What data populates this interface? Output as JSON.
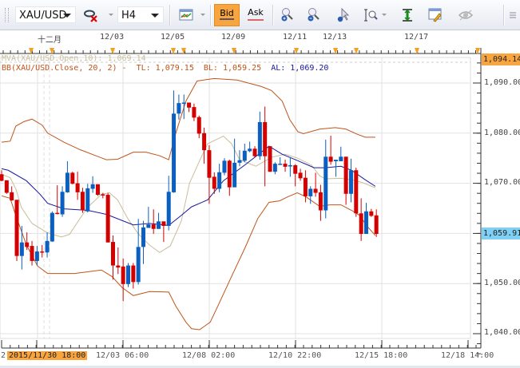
{
  "toolbar": {
    "symbol": "XAU/USD",
    "timeframe": "H4",
    "bid_label": "Bid",
    "ask_label": "Ask",
    "icons": [
      "remove-indicator-icon",
      "chart-type-icon",
      "zoom-in-icon",
      "zoom-out-icon",
      "cursor-zoom-icon",
      "zoom-range-icon",
      "crosshair-icon",
      "edit-icon",
      "eye-icon",
      "menu-icon"
    ]
  },
  "ruler": {
    "labels": [
      "十二月",
      "12/03",
      "12/05",
      "12/09",
      "12/11",
      "12/13",
      "12/17"
    ]
  },
  "legend": {
    "mva": "MVA(XAU/USD.Open,10): 1,069.14",
    "bb_name": "BB(XAU/USD.Close, 20, 2) -",
    "tl": "TL: 1,079.15",
    "bl": "BL: 1,059.25",
    "al": "AL: 1,069.20"
  },
  "price_axis": {
    "labels": [
      "1,090.00",
      "1,080.00",
      "1,070.00",
      "1,050.00",
      "1,040.00"
    ],
    "high_marker": "1,094.14",
    "current_price": "1,059.91"
  },
  "time_axis": {
    "highlighted": "2015/11/30 18:00",
    "clipped_prefix": "2",
    "labels": [
      "12/03 06:00",
      "12/08 02:00",
      "12/10 22:00",
      "12/15 18:00",
      "12/18 14:00"
    ]
  },
  "colors": {
    "up": "#0a5fc0",
    "down": "#d40000",
    "bands": "#c0541a",
    "mid": "#1818a0",
    "mva": "#c9bd98",
    "accent": "#f9a53f",
    "current": "#7fd0f5"
  },
  "chart_data": {
    "type": "candlestick",
    "title": "XAU/USD H4",
    "ylim": [
      1036.5,
      1095.5
    ],
    "yticks": [
      1040,
      1050,
      1060,
      1070,
      1080,
      1090
    ],
    "ohlc": [
      [
        1071.8,
        1072.6,
        1070.4,
        1070.5
      ],
      [
        1070.6,
        1070.6,
        1067.9,
        1068.1
      ],
      [
        1068.2,
        1069.4,
        1066.5,
        1066.6
      ],
      [
        1066.7,
        1066.7,
        1054.5,
        1055.5
      ],
      [
        1055.5,
        1061.5,
        1052.8,
        1058.2
      ],
      [
        1058.2,
        1060.2,
        1056.7,
        1057.3
      ],
      [
        1057.5,
        1058.5,
        1053.6,
        1054.5
      ],
      [
        1054.5,
        1057.5,
        1053.6,
        1056.4
      ],
      [
        1056.4,
        1057.7,
        1055.2,
        1056.3
      ],
      [
        1056.2,
        1060.2,
        1055.2,
        1058.5
      ],
      [
        1058.4,
        1064.4,
        1058.3,
        1064.1
      ],
      [
        1064.1,
        1069.6,
        1063.8,
        1063.9
      ],
      [
        1063.8,
        1069.4,
        1063.3,
        1068.3
      ],
      [
        1068.2,
        1074.4,
        1068.1,
        1072.1
      ],
      [
        1072.1,
        1072.3,
        1069.8,
        1069.9
      ],
      [
        1070.0,
        1072.3,
        1066.7,
        1068.2
      ],
      [
        1068.3,
        1069.1,
        1064.1,
        1064.6
      ],
      [
        1064.4,
        1069.9,
        1064.2,
        1069.0
      ],
      [
        1068.9,
        1071.4,
        1068.1,
        1069.8
      ],
      [
        1069.8,
        1069.8,
        1067.5,
        1067.7
      ],
      [
        1067.8,
        1068.1,
        1067.0,
        1067.7
      ],
      [
        1067.7,
        1068.1,
        1058.2,
        1058.2
      ],
      [
        1058.3,
        1059.6,
        1050.8,
        1053.6
      ],
      [
        1053.6,
        1057.2,
        1051.9,
        1053.2
      ],
      [
        1053.4,
        1055.0,
        1046.5,
        1049.9
      ],
      [
        1049.9,
        1054.1,
        1049.3,
        1053.6
      ],
      [
        1053.6,
        1054.1,
        1049.0,
        1050.3
      ],
      [
        1050.3,
        1062.9,
        1049.8,
        1057.3
      ],
      [
        1057.3,
        1062.5,
        1053.9,
        1061.2
      ],
      [
        1061.1,
        1065.3,
        1061.1,
        1061.8
      ],
      [
        1061.8,
        1064.8,
        1059.9,
        1060.9
      ],
      [
        1060.9,
        1064.1,
        1060.9,
        1062.4
      ],
      [
        1062.4,
        1062.4,
        1058.3,
        1061.5
      ],
      [
        1061.5,
        1071.5,
        1060.6,
        1068.3
      ],
      [
        1068.2,
        1088.5,
        1068.1,
        1083.9
      ],
      [
        1083.9,
        1087.7,
        1082.7,
        1086.0
      ],
      [
        1086.0,
        1087.7,
        1082.8,
        1086.1
      ],
      [
        1086.1,
        1086.1,
        1084.2,
        1085.1
      ],
      [
        1085.2,
        1085.9,
        1082.4,
        1083.1
      ],
      [
        1083.2,
        1083.5,
        1079.0,
        1079.9
      ],
      [
        1080.0,
        1081.1,
        1073.9,
        1076.6
      ],
      [
        1076.6,
        1077.6,
        1065.9,
        1071.1
      ],
      [
        1071.3,
        1072.2,
        1067.9,
        1068.9
      ],
      [
        1068.9,
        1073.9,
        1068.2,
        1072.2
      ],
      [
        1072.1,
        1075.0,
        1071.6,
        1074.5
      ],
      [
        1074.5,
        1074.7,
        1067.5,
        1069.2
      ],
      [
        1069.2,
        1078.9,
        1069.2,
        1074.1
      ],
      [
        1074.1,
        1076.6,
        1073.4,
        1074.6
      ],
      [
        1074.5,
        1077.9,
        1074.2,
        1076.5
      ],
      [
        1076.4,
        1078.3,
        1076.2,
        1076.9
      ],
      [
        1076.9,
        1077.4,
        1075.2,
        1075.4
      ],
      [
        1075.4,
        1084.3,
        1074.7,
        1082.2
      ],
      [
        1082.2,
        1085.3,
        1069.4,
        1075.4
      ],
      [
        1077.4,
        1077.4,
        1072.3,
        1072.3
      ],
      [
        1072.3,
        1074.2,
        1071.8,
        1073.9
      ],
      [
        1073.8,
        1075.2,
        1073.7,
        1073.9
      ],
      [
        1073.9,
        1074.7,
        1072.3,
        1073.3
      ],
      [
        1073.5,
        1075.2,
        1071.3,
        1073.6
      ],
      [
        1073.6,
        1073.8,
        1069.4,
        1071.9
      ],
      [
        1072.1,
        1072.9,
        1070.5,
        1071.0
      ],
      [
        1071.1,
        1072.6,
        1066.2,
        1067.4
      ],
      [
        1067.4,
        1069.4,
        1065.9,
        1068.9
      ],
      [
        1068.9,
        1072.1,
        1067.3,
        1068.1
      ],
      [
        1068.2,
        1069.7,
        1062.5,
        1064.6
      ],
      [
        1064.6,
        1078.7,
        1063.0,
        1075.3
      ],
      [
        1075.3,
        1079.5,
        1073.7,
        1074.3
      ],
      [
        1074.4,
        1074.7,
        1071.3,
        1074.7
      ],
      [
        1074.4,
        1077.3,
        1074.4,
        1075.3
      ],
      [
        1075.3,
        1075.3,
        1065.7,
        1067.9
      ],
      [
        1067.9,
        1074.9,
        1066.2,
        1072.6
      ],
      [
        1072.6,
        1073.1,
        1063.3,
        1064.0
      ],
      [
        1064.0,
        1067.0,
        1058.5,
        1059.9
      ],
      [
        1059.9,
        1066.1,
        1059.9,
        1064.4
      ],
      [
        1064.4,
        1064.9,
        1063.3,
        1063.5
      ],
      [
        1063.6,
        1064.8,
        1059.3,
        1059.9
      ]
    ],
    "bb_upper": [
      [
        0,
        1078.2
      ],
      [
        1.7,
        1078.4
      ],
      [
        2.8,
        1081.4
      ],
      [
        4.4,
        1082.3
      ],
      [
        6,
        1082.8
      ],
      [
        8,
        1081.6
      ],
      [
        9.1,
        1080.0
      ],
      [
        12.3,
        1078.2
      ],
      [
        15.5,
        1076.7
      ],
      [
        18.6,
        1075.5
      ],
      [
        20.7,
        1074.7
      ],
      [
        22.9,
        1074.8
      ],
      [
        26,
        1076.2
      ],
      [
        28.5,
        1076.2
      ],
      [
        31.2,
        1075.5
      ],
      [
        33,
        1074.7
      ],
      [
        34.4,
        1080.0
      ],
      [
        36.4,
        1086.4
      ],
      [
        38.6,
        1090.4
      ],
      [
        42,
        1090.9
      ],
      [
        46.5,
        1090.6
      ],
      [
        51.3,
        1089.3
      ],
      [
        53.3,
        1088.5
      ],
      [
        55.4,
        1086.4
      ],
      [
        56.9,
        1082.7
      ],
      [
        58.5,
        1080.3
      ],
      [
        59.6,
        1079.9
      ],
      [
        62.8,
        1080.8
      ],
      [
        65.9,
        1081.1
      ],
      [
        68,
        1080.8
      ],
      [
        70.2,
        1079.8
      ],
      [
        71.8,
        1079.2
      ],
      [
        73.8,
        1079.2
      ]
    ],
    "bb_lower": [
      [
        0,
        1067.5
      ],
      [
        1.7,
        1067.0
      ],
      [
        2.8,
        1063.6
      ],
      [
        4.9,
        1057.7
      ],
      [
        7.1,
        1053.5
      ],
      [
        9.1,
        1052.0
      ],
      [
        14.4,
        1052.0
      ],
      [
        19.7,
        1052.7
      ],
      [
        21.8,
        1051.4
      ],
      [
        23.8,
        1049.2
      ],
      [
        26,
        1047.6
      ],
      [
        29.2,
        1048.4
      ],
      [
        33,
        1048.3
      ],
      [
        34.4,
        1045.5
      ],
      [
        36.4,
        1042.3
      ],
      [
        37.5,
        1041.0
      ],
      [
        39.1,
        1040.8
      ],
      [
        41.2,
        1042.3
      ],
      [
        42.7,
        1045.5
      ],
      [
        45.4,
        1051.4
      ],
      [
        48.1,
        1057.2
      ],
      [
        50.6,
        1063.0
      ],
      [
        52.8,
        1066.2
      ],
      [
        54.9,
        1066.5
      ],
      [
        56.5,
        1067.3
      ],
      [
        58.4,
        1068.1
      ],
      [
        60.1,
        1067.3
      ],
      [
        62.8,
        1065.4
      ],
      [
        64.8,
        1065.7
      ],
      [
        67,
        1065.7
      ],
      [
        69.1,
        1064.6
      ],
      [
        70.7,
        1063.6
      ],
      [
        72.2,
        1061.4
      ],
      [
        73.8,
        1059.6
      ]
    ],
    "bb_mid": [
      [
        0,
        1072.9
      ],
      [
        1.3,
        1072.6
      ],
      [
        4.9,
        1070.5
      ],
      [
        7.6,
        1067.8
      ],
      [
        9.1,
        1066.0
      ],
      [
        12.3,
        1064.9
      ],
      [
        17,
        1064.6
      ],
      [
        20.7,
        1063.8
      ],
      [
        26,
        1061.7
      ],
      [
        29.2,
        1062.0
      ],
      [
        33,
        1061.6
      ],
      [
        35.5,
        1063.6
      ],
      [
        37.5,
        1065.3
      ],
      [
        40.7,
        1066.7
      ],
      [
        43.8,
        1070.5
      ],
      [
        48.1,
        1073.7
      ],
      [
        52.8,
        1077.4
      ],
      [
        55.4,
        1075.8
      ],
      [
        58.5,
        1074.5
      ],
      [
        61.7,
        1073.1
      ],
      [
        63.9,
        1073.1
      ],
      [
        67,
        1073.4
      ],
      [
        69.1,
        1072.6
      ],
      [
        71.8,
        1070.7
      ],
      [
        73.8,
        1069.4
      ]
    ],
    "mva": [
      [
        0,
        1071.8
      ],
      [
        1.7,
        1071.1
      ],
      [
        2.8,
        1068.9
      ],
      [
        3.9,
        1065.2
      ],
      [
        6,
        1062.0
      ],
      [
        9.1,
        1060.1
      ],
      [
        11.8,
        1059.3
      ],
      [
        13.4,
        1059.8
      ],
      [
        15.5,
        1063.0
      ],
      [
        17,
        1065.2
      ],
      [
        19.7,
        1067.8
      ],
      [
        21.3,
        1068.1
      ],
      [
        22.9,
        1066.7
      ],
      [
        24.9,
        1063.0
      ],
      [
        27,
        1059.9
      ],
      [
        29.2,
        1057.7
      ],
      [
        31.2,
        1056.2
      ],
      [
        33.3,
        1057.5
      ],
      [
        35.5,
        1062.5
      ],
      [
        37.1,
        1070.0
      ],
      [
        39.1,
        1074.5
      ],
      [
        40.7,
        1077.9
      ],
      [
        43.8,
        1079.4
      ],
      [
        45.4,
        1077.9
      ],
      [
        47,
        1074.7
      ],
      [
        50.2,
        1073.4
      ],
      [
        53.3,
        1075.2
      ],
      [
        56,
        1075.8
      ],
      [
        58.5,
        1075.0
      ],
      [
        61.2,
        1073.6
      ],
      [
        62.8,
        1071.5
      ],
      [
        63.9,
        1070.9
      ],
      [
        67,
        1071.0
      ],
      [
        69.1,
        1070.7
      ],
      [
        71.1,
        1070.2
      ],
      [
        73.8,
        1069.1
      ]
    ]
  }
}
